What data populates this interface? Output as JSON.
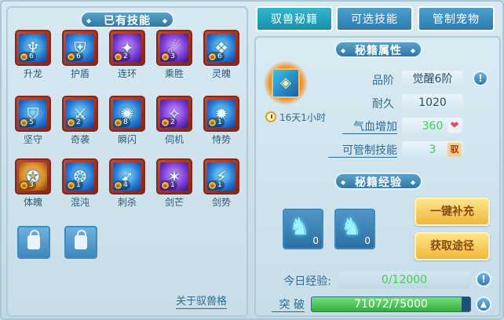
{
  "left_panel": {
    "title": "已有技能",
    "skills": [
      {
        "name": "升龙",
        "level": "6",
        "glyph": "♆",
        "tone": "blue"
      },
      {
        "name": "护盾",
        "level": "6",
        "glyph": "⛨",
        "tone": "blue"
      },
      {
        "name": "连环",
        "level": "2",
        "glyph": "✦",
        "tone": "purple"
      },
      {
        "name": "乘胜",
        "level": "3",
        "glyph": "☄",
        "tone": "purple"
      },
      {
        "name": "灵魄",
        "level": "6",
        "glyph": "❖",
        "tone": "blue"
      },
      {
        "name": "坚守",
        "level": "5",
        "glyph": "⛉",
        "tone": "blue"
      },
      {
        "name": "奇袭",
        "level": "2",
        "glyph": "⚔",
        "tone": "blue"
      },
      {
        "name": "瞬闪",
        "level": "8",
        "glyph": "✺",
        "tone": "blue"
      },
      {
        "name": "伺机",
        "level": "2",
        "glyph": "✧",
        "tone": "purple"
      },
      {
        "name": "恃势",
        "level": "1",
        "glyph": "✹",
        "tone": "blue"
      },
      {
        "name": "体魄",
        "level": "3",
        "glyph": "✪",
        "tone": "orange"
      },
      {
        "name": "混沌",
        "level": "1",
        "glyph": "❂",
        "tone": "blue"
      },
      {
        "name": "刺杀",
        "level": "4",
        "glyph": "➹",
        "tone": "blue"
      },
      {
        "name": "剑芒",
        "level": "1",
        "glyph": "✶",
        "tone": "purple"
      },
      {
        "name": "剑势",
        "level": "1",
        "glyph": "⚡",
        "tone": "blue"
      }
    ],
    "about_link": "关于驭兽格"
  },
  "tabs": [
    {
      "label": "驭兽秘籍",
      "active": true
    },
    {
      "label": "可选技能",
      "active": false
    },
    {
      "label": "管制宠物",
      "active": false
    }
  ],
  "attributes": {
    "title": "秘籍属性",
    "time_left": "16天1小时",
    "grade_label": "品阶",
    "grade_value": "觉醒6阶",
    "durability_label": "耐久",
    "durability_value": "1020",
    "hp_label": "气血增加",
    "hp_value": "360",
    "control_label": "可管制技能",
    "control_value": "3",
    "control_tag": "驭"
  },
  "experience": {
    "title": "秘籍经验",
    "items": [
      {
        "count": "0"
      },
      {
        "count": "0"
      }
    ],
    "refill_button": "一键补充",
    "obtain_button": "获取途径",
    "today_label": "今日经验:",
    "today_value": "0/12000",
    "breakthrough_label": "突 破",
    "breakthrough_value": "71072/75000",
    "breakthrough_fraction": 0.9476
  },
  "colors": {
    "accent": "#2e78a6",
    "green": "#3bd24a"
  }
}
